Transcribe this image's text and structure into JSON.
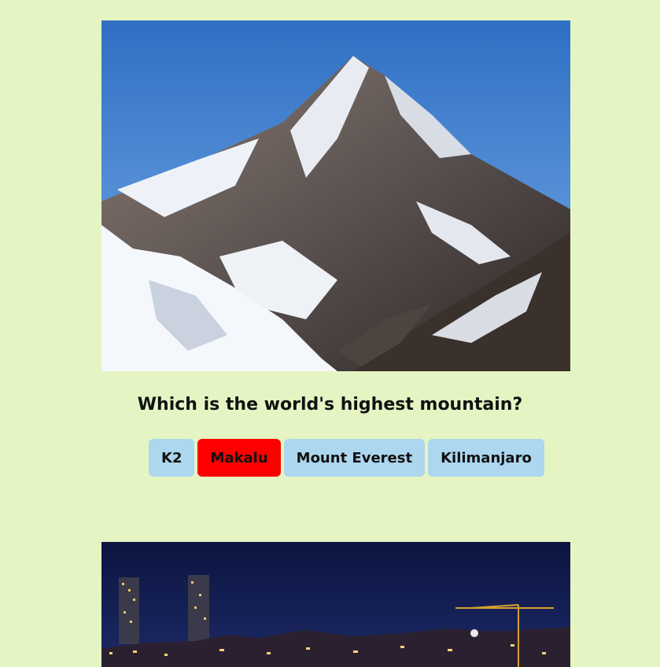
{
  "colors": {
    "page_background": "#e4f5c3",
    "answer_background": "#add6ef",
    "answer_wrong_background": "#ff0000"
  },
  "question_1": {
    "image": "mountain-photo",
    "question": "Which is the world's highest mountain?",
    "answers": [
      {
        "label": "K2",
        "state": "default"
      },
      {
        "label": "Makalu",
        "state": "wrong"
      },
      {
        "label": "Mount Everest",
        "state": "default"
      },
      {
        "label": "Kilimanjaro",
        "state": "default"
      }
    ]
  },
  "question_2": {
    "image": "night-city-skyline-photo"
  }
}
